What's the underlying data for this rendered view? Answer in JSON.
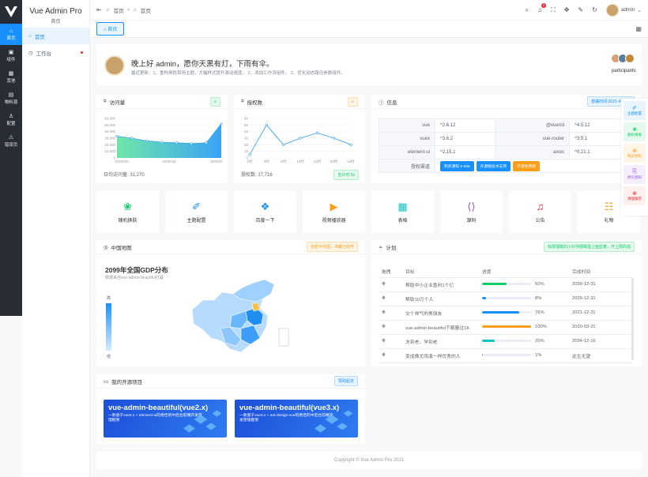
{
  "rail": {
    "items": [
      {
        "label": "首页",
        "icon": "home-icon"
      },
      {
        "label": "组件",
        "icon": "cube-icon"
      },
      {
        "label": "其他",
        "icon": "grid-icon"
      },
      {
        "label": "物料源",
        "icon": "box-icon"
      },
      {
        "label": "配置",
        "icon": "user-icon"
      },
      {
        "label": "错误页",
        "icon": "warning-icon"
      }
    ]
  },
  "sub": {
    "title": "Vue Admin Pro",
    "subtitle": "首页",
    "items": [
      {
        "label": "首页"
      },
      {
        "label": "工作台"
      }
    ]
  },
  "topbar": {
    "crumbs": [
      "首页",
      "首页"
    ],
    "badge": "3",
    "username": "admin"
  },
  "tabs": {
    "active": "首页"
  },
  "greeting": {
    "title": "晚上好 admin，愿你天黑有灯，下雨有伞。",
    "sub": "最近更新：1、重构俱防菜场主题，大幅样式提升滚动速度。 2、添加工作流组件。 3、优化动态路径参数组件。",
    "participants": "participants"
  },
  "visits": {
    "title": "访问量",
    "footer": "日均访问量: 31,270",
    "chart_data": {
      "type": "area",
      "x": [
        "2020/2/6",
        "2020/2/8",
        "2020/2/"
      ],
      "values": [
        33000,
        30000,
        26000,
        24000,
        23000,
        22000,
        23000,
        52000
      ],
      "yticks": [
        "60,000",
        "50,000",
        "40,000",
        "30,000",
        "20,000",
        "10,000",
        "0"
      ],
      "ylim": [
        0,
        60000
      ]
    }
  },
  "auth": {
    "title": "授权数",
    "footer": "授权数: 17,716",
    "tag": "告计时 5s",
    "chart_data": {
      "type": "line",
      "categories": [
        "0时",
        "4时",
        "8时",
        "12时",
        "16时",
        "20时",
        "24时"
      ],
      "values": [
        5,
        50,
        20,
        30,
        38,
        30,
        20
      ],
      "yticks": [
        "60",
        "50",
        "40",
        "30",
        "20",
        "10",
        "0"
      ],
      "ylim": [
        0,
        60
      ]
    }
  },
  "info": {
    "title": "信息",
    "tag": "部署时间:2021-4-6 14:",
    "rows": [
      {
        "k1": "vue",
        "v1": "^2.6.12",
        "k2": "@vue/cli",
        "v2": "^4.5.12"
      },
      {
        "k1": "vuex",
        "v1": "^3.6.2",
        "k2": "vue-router",
        "v2": "^3.5.1"
      },
      {
        "k1": "element-ui",
        "v1": "^2.15.1",
        "k2": "axios",
        "v2": "^0.21.1"
      }
    ],
    "auth_label": "授权渠道",
    "buttons": [
      {
        "label": "购买源码 ¥ 699",
        "color": "#1890ff"
      },
      {
        "label": "开源版技术支持",
        "color": "#1890ff"
      },
      {
        "label": "开源免费版",
        "color": "#fa9e1b"
      }
    ]
  },
  "quick": [
    {
      "label": "随机换肤",
      "icon": "palette-icon",
      "color": "#13ce66"
    },
    {
      "label": "主题配置",
      "icon": "brush-icon",
      "color": "#1890ff"
    },
    {
      "label": "百度一下",
      "icon": "paw-icon",
      "color": "#1890ff"
    },
    {
      "label": "视频播放器",
      "icon": "video-icon",
      "color": "#fa9e1b"
    },
    {
      "label": "表格",
      "icon": "table-icon",
      "color": "#13c2c2"
    },
    {
      "label": "源码",
      "icon": "code-icon",
      "color": "#9254de"
    },
    {
      "label": "公告",
      "icon": "bell-icon",
      "color": "#f5222d"
    },
    {
      "label": "礼物",
      "icon": "gift-icon",
      "color": "#fa9e1b"
    }
  ],
  "map": {
    "title": "中国地图",
    "tag": "他爱中中国，书都已完毕",
    "heading": "2099年全国GDP分布",
    "source": "数据来自vue-admin-beautiful打赢",
    "legend_high": "高",
    "legend_low": "低"
  },
  "plan": {
    "title": "计划",
    "tag": "权限理赋的小伙伴都赋指上面显着，开上限的值",
    "headers": [
      "拖拽",
      "目标",
      "进度",
      "完成时间"
    ],
    "rows": [
      {
        "goal": "帮助中小企业盈利1个亿",
        "pct": 50,
        "pct_label": "50%",
        "color": "#13ce66",
        "date": "2099-12-31"
      },
      {
        "goal": "帮助10万个人",
        "pct": 8,
        "pct_label": "8%",
        "color": "#1890ff",
        "date": "2029-12-31"
      },
      {
        "goal": "交个帅气的男朋友",
        "pct": 76,
        "pct_label": "76%",
        "color": "#1890ff",
        "date": "2021-12-31"
      },
      {
        "goal": "vue-admin-beautiful下载量过1K",
        "pct": 100,
        "pct_label": "100%",
        "color": "#fa9e1b",
        "date": "2020-03-31"
      },
      {
        "goal": "冻到老，学到老",
        "pct": 25,
        "pct_label": "25%",
        "color": "#13c2c2",
        "date": "2094-12-16"
      },
      {
        "goal": "变成像尤雨溪一样优秀的人",
        "pct": 1,
        "pct_label": "1%",
        "color": "#909399",
        "date": "此生无望"
      }
    ]
  },
  "projects": {
    "title": "我的开源项目",
    "tag": "赞助起走",
    "items": [
      {
        "title": "vue-admin-beautiful(vue2.x)",
        "desc": "一款基于vue2.x + element-ui的绝佳的中后台前端开发管理框架"
      },
      {
        "title": "vue-admin-beautiful(vue3.x)",
        "desc": "一款基于vue3.x + ant-design-vue的绝佳的中后台前端开发管理框架"
      }
    ]
  },
  "side": [
    {
      "label": "主题配置",
      "color": "#1890ff",
      "bg": "#e8f4ff"
    },
    {
      "label": "随机换肤",
      "color": "#13ce66",
      "bg": "#e6f9ee"
    },
    {
      "label": "购买源码",
      "color": "#fa9e1b",
      "bg": "#fff5e6"
    },
    {
      "label": "拷贝源码",
      "color": "#9254de",
      "bg": "#f4eeff"
    },
    {
      "label": "清理缓存",
      "color": "#f5222d",
      "bg": "#fff0f0"
    }
  ],
  "footer": "Copyright © Vue Admin Pro 2021"
}
